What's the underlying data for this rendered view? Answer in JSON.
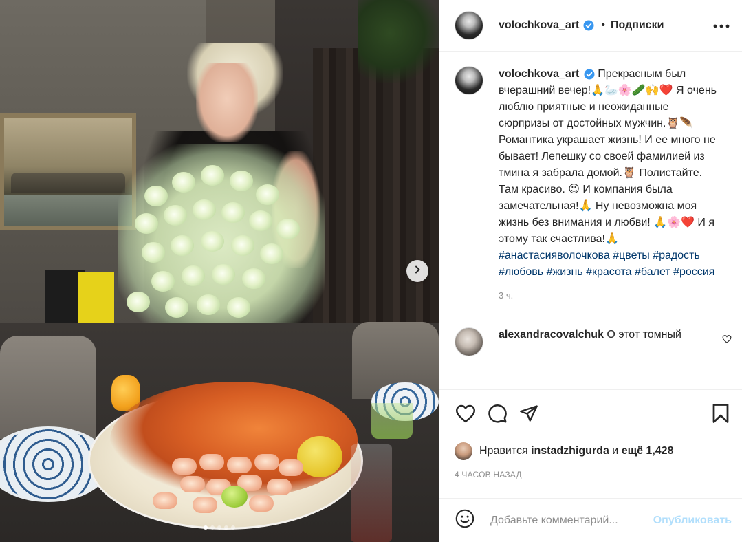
{
  "post": {
    "username": "volochkova_art",
    "follow_label": "Подписки",
    "bullet": "•",
    "caption": {
      "text": "Прекрасным был вчерашний вечер!🙏🦢🌸🥒🙌❤️ Я очень люблю приятные и неожиданные сюрпризы от достойных мужчин.🦉🪶 Романтика украшает жизнь! И ее много не бывает! Лепешку со своей фамилией из тмина я забрала домой.🦉 Полистайте. Там красиво. 😉 И компания была замечательная!🙏 Ну невозможна моя жизнь без внимания и любви! 🙏🌸❤️ И я этому так счастлива!🙏",
      "hashtags": [
        "#анастасияволочкова",
        "#цветы",
        "#радость",
        "#любовь",
        "#жизнь",
        "#красота",
        "#балет",
        "#россия"
      ],
      "time": "3 ч."
    },
    "comment": {
      "username": "alexandracovalchuk",
      "text": "О этот томный"
    },
    "likes": {
      "prefix": "Нравится",
      "user": "instadzhigurda",
      "and": "и",
      "count": "ещё 1,428"
    },
    "posted_ago": "4 ЧАСОВ НАЗАД",
    "add_comment": {
      "placeholder": "Добавьте комментарий...",
      "publish_label": "Опубликовать"
    },
    "carousel": {
      "total_slides": 5,
      "active_slide": 1
    }
  },
  "icons": {
    "verified": "verified-badge-icon",
    "more": "more-options-icon",
    "next": "chevron-right-icon",
    "like": "heart-icon",
    "comment": "comment-bubble-icon",
    "share": "paper-plane-icon",
    "save": "bookmark-icon",
    "emoji": "smiley-icon"
  },
  "colors": {
    "verified_blue": "#3897f0",
    "hashtag": "#00376b",
    "publish_disabled": "#b2dffc",
    "muted": "#8e8e8e"
  }
}
